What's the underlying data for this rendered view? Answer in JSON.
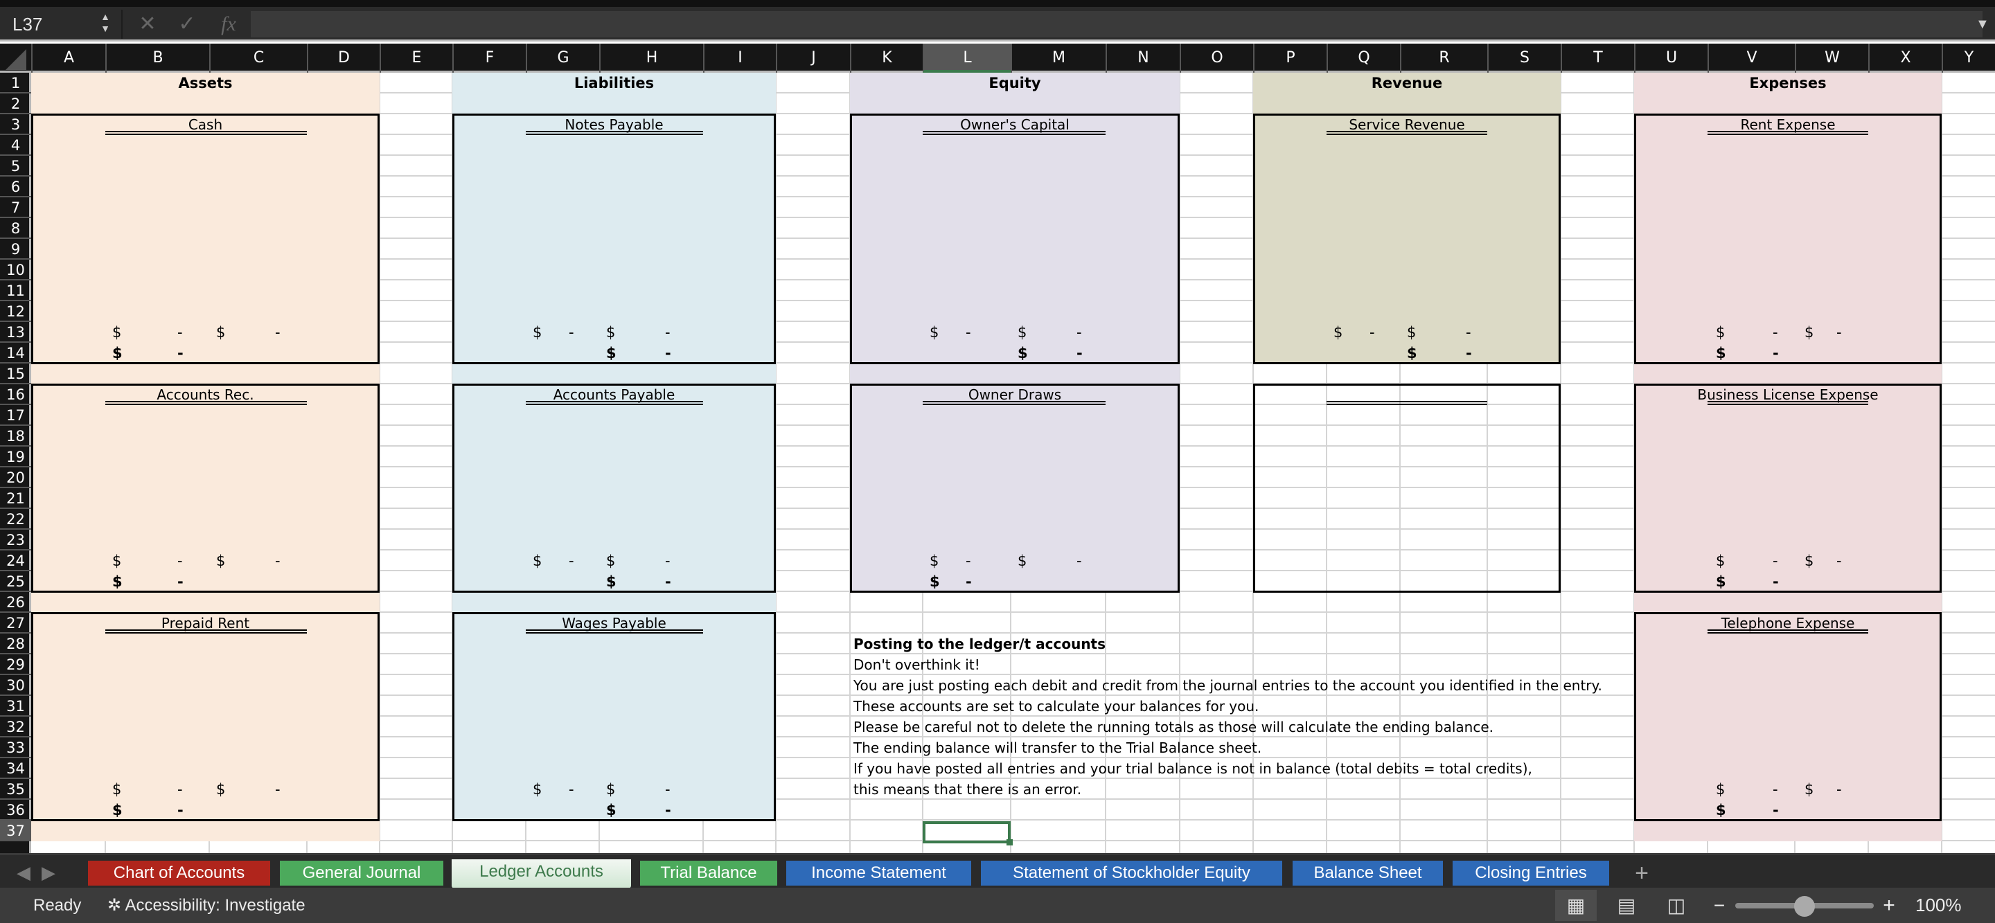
{
  "app": {
    "name_box": "L37",
    "formula_value": ""
  },
  "formula_bar": {
    "cancel_icon": "✕",
    "confirm_icon": "✓",
    "fx_label": "fx"
  },
  "columns": [
    "A",
    "B",
    "C",
    "D",
    "E",
    "F",
    "G",
    "H",
    "I",
    "J",
    "K",
    "L",
    "M",
    "N",
    "O",
    "P",
    "Q",
    "R",
    "S",
    "T",
    "U",
    "V",
    "W",
    "X",
    "Y"
  ],
  "selected_column": "L",
  "selected_row": 37,
  "rows": [
    1,
    2,
    3,
    4,
    5,
    6,
    7,
    8,
    9,
    10,
    11,
    12,
    13,
    14,
    15,
    16,
    17,
    18,
    19,
    20,
    21,
    22,
    23,
    24,
    25,
    26,
    27,
    28,
    29,
    30,
    31,
    32,
    33,
    34,
    35,
    36,
    37
  ],
  "sections": {
    "assets": {
      "title": "Assets",
      "color": "#faeadc",
      "accounts": [
        "Cash",
        "Accounts Rec.",
        "Prepaid Rent"
      ]
    },
    "liabilities": {
      "title": "Liabilities",
      "color": "#ddebf0",
      "accounts": [
        "Notes Payable",
        "Accounts Payable",
        "Wages Payable"
      ]
    },
    "equity": {
      "title": "Equity",
      "color": "#e2dfea",
      "accounts": [
        "Owner's Capital",
        "Owner Draws"
      ]
    },
    "revenue": {
      "title": "Revenue",
      "color": "#dcdac6",
      "accounts": [
        "Service Revenue",
        ""
      ]
    },
    "expenses": {
      "title": "Expenses",
      "color": "#efdcdd",
      "accounts": [
        "Rent Expense",
        "Business License Expense",
        "Telephone Expense"
      ]
    }
  },
  "amounts": {
    "currency": "$",
    "zero": "-"
  },
  "notes": [
    "Posting to the ledger/t accounts",
    "Don't overthink it!",
    "You are just posting each debit and credit from the journal entries to the account you identified in the entry.",
    "These accounts are set to calculate your balances for you.",
    "Please be careful not to delete the running totals as those will calculate the ending balance.",
    "The ending balance will transfer to the Trial Balance sheet.",
    "If you have posted all entries and your trial balance is not in balance (total debits = total credits),",
    "this means that there is an error."
  ],
  "sheet_tabs": [
    {
      "label": "Chart of Accounts",
      "color": "#b0251c",
      "active": false
    },
    {
      "label": "General Journal",
      "color": "#4caa5c",
      "active": false
    },
    {
      "label": "Ledger Accounts",
      "color": "#4caa5c",
      "active": true
    },
    {
      "label": "Trial Balance",
      "color": "#4caa5c",
      "active": false
    },
    {
      "label": "Income Statement",
      "color": "#2e6ab8",
      "active": false
    },
    {
      "label": "Statement of Stockholder Equity",
      "color": "#2e6ab8",
      "active": false
    },
    {
      "label": "Balance Sheet",
      "color": "#2e6ab8",
      "active": false
    },
    {
      "label": "Closing Entries",
      "color": "#2e6ab8",
      "active": false
    }
  ],
  "tab_add": "+",
  "status": {
    "ready": "Ready",
    "accessibility": "Accessibility: Investigate",
    "zoom": "100%",
    "zoom_value_percent": 100
  }
}
